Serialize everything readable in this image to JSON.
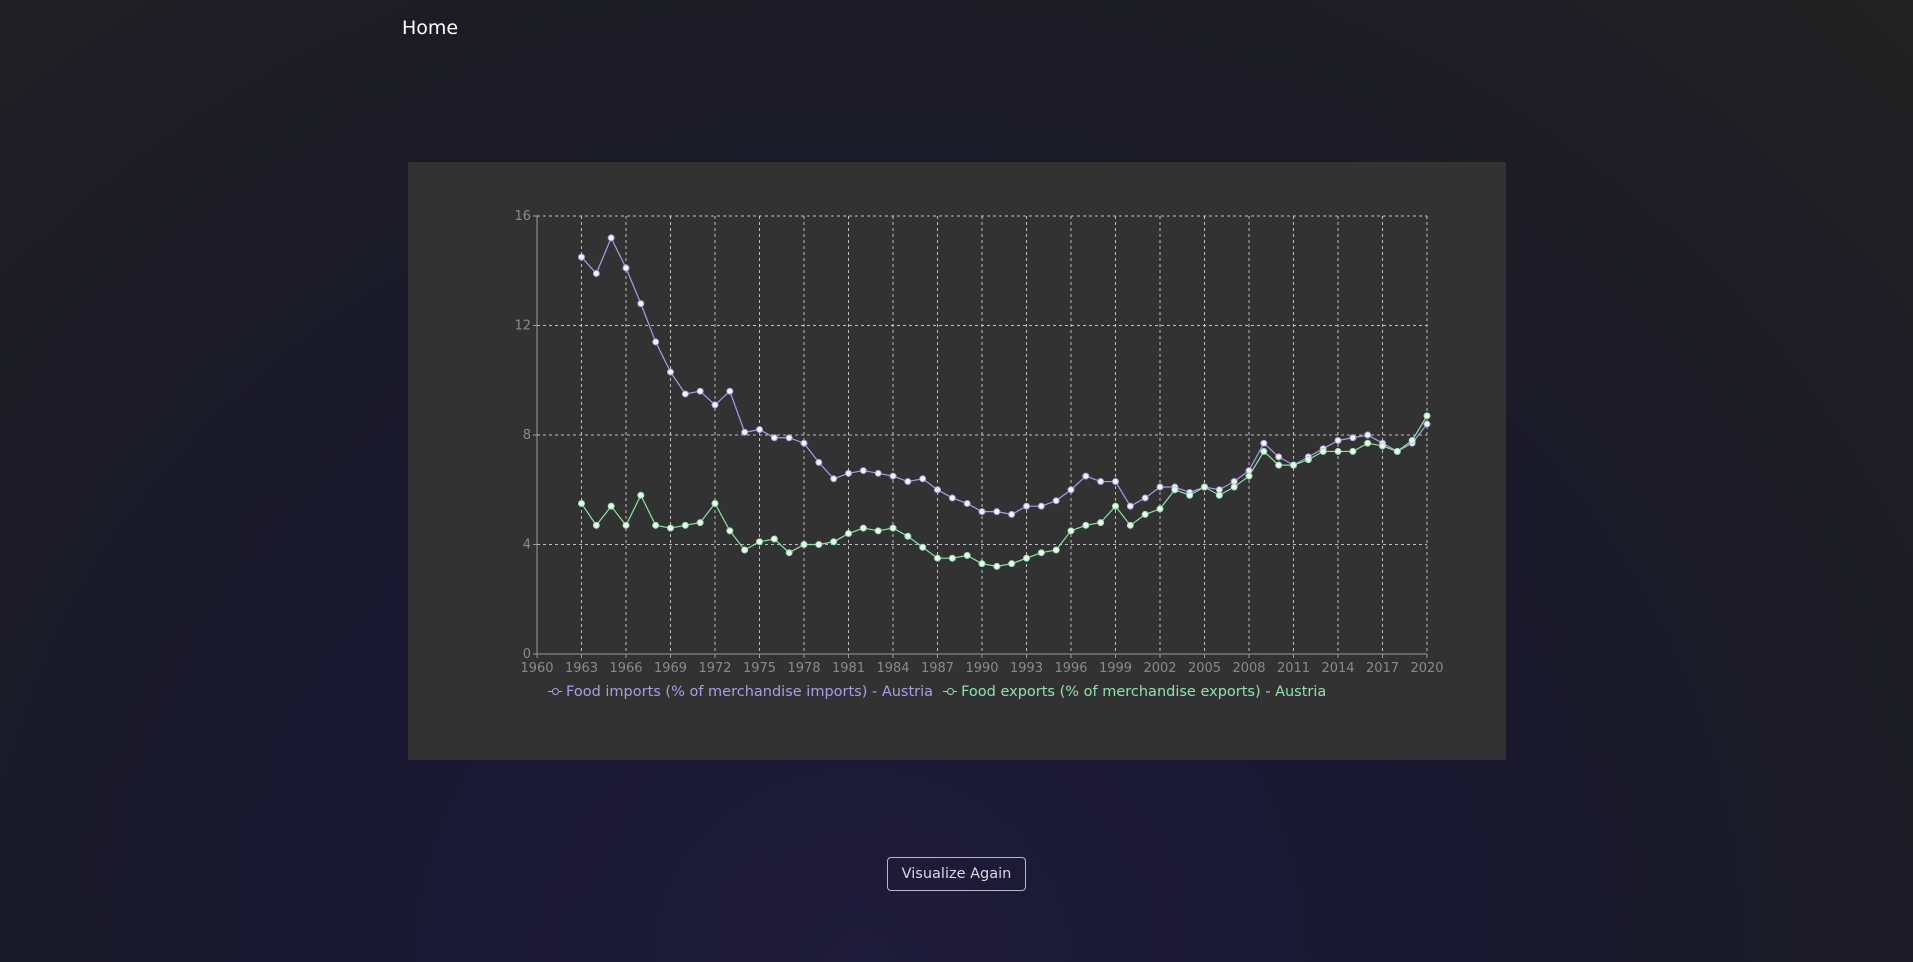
{
  "nav": {
    "home_label": "Home"
  },
  "button": {
    "visualize_again_label": "Visualize Again"
  },
  "colors": {
    "imports": "#a99de8",
    "exports": "#8ee3a8",
    "grid": "#d8d8d8",
    "point_fill": "#f4f4f4"
  },
  "chart_data": {
    "type": "line",
    "xlim": [
      1960,
      2020
    ],
    "ylim": [
      0,
      16
    ],
    "x_ticks": [
      1960,
      1963,
      1966,
      1969,
      1972,
      1975,
      1978,
      1981,
      1984,
      1987,
      1990,
      1993,
      1996,
      1999,
      2002,
      2005,
      2008,
      2011,
      2014,
      2017,
      2020
    ],
    "y_ticks": [
      0,
      4,
      8,
      12,
      16
    ],
    "grid": true,
    "legend_position": "bottom",
    "x": [
      1963,
      1964,
      1965,
      1966,
      1967,
      1968,
      1969,
      1970,
      1971,
      1972,
      1973,
      1974,
      1975,
      1976,
      1977,
      1978,
      1979,
      1980,
      1981,
      1982,
      1983,
      1984,
      1985,
      1986,
      1987,
      1988,
      1989,
      1990,
      1991,
      1992,
      1993,
      1994,
      1995,
      1996,
      1997,
      1998,
      1999,
      2000,
      2001,
      2002,
      2003,
      2004,
      2005,
      2006,
      2007,
      2008,
      2009,
      2010,
      2011,
      2012,
      2013,
      2014,
      2015,
      2016,
      2017,
      2018,
      2019,
      2020
    ],
    "series": [
      {
        "name": "Food imports (% of merchandise imports) - Austria",
        "values": [
          14.5,
          13.9,
          15.2,
          14.1,
          12.8,
          11.4,
          10.3,
          9.5,
          9.6,
          9.1,
          9.6,
          8.1,
          8.2,
          7.9,
          7.9,
          7.7,
          7.0,
          6.4,
          6.6,
          6.7,
          6.6,
          6.5,
          6.3,
          6.4,
          6.0,
          5.7,
          5.5,
          5.2,
          5.2,
          5.1,
          5.4,
          5.4,
          5.6,
          6.0,
          6.5,
          6.3,
          6.3,
          5.4,
          5.7,
          6.1,
          6.1,
          5.9,
          6.1,
          6.0,
          6.3,
          6.7,
          7.7,
          7.2,
          6.9,
          7.2,
          7.5,
          7.8,
          7.9,
          8.0,
          7.7,
          7.4,
          7.7,
          8.4
        ]
      },
      {
        "name": "Food exports (% of merchandise exports) - Austria",
        "values": [
          5.5,
          4.7,
          5.4,
          4.7,
          5.8,
          4.7,
          4.6,
          4.7,
          4.8,
          5.5,
          4.5,
          3.8,
          4.1,
          4.2,
          3.7,
          4.0,
          4.0,
          4.1,
          4.4,
          4.6,
          4.5,
          4.6,
          4.3,
          3.9,
          3.5,
          3.5,
          3.6,
          3.3,
          3.2,
          3.3,
          3.5,
          3.7,
          3.8,
          4.5,
          4.7,
          4.8,
          5.4,
          4.7,
          5.1,
          5.3,
          6.0,
          5.8,
          6.1,
          5.8,
          6.1,
          6.5,
          7.4,
          6.9,
          6.9,
          7.1,
          7.4,
          7.4,
          7.4,
          7.7,
          7.6,
          7.4,
          7.8,
          8.7
        ]
      }
    ]
  }
}
